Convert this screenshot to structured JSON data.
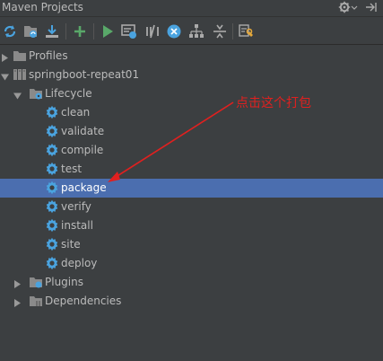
{
  "window": {
    "title": "Maven Projects"
  },
  "toolbar": {
    "icons": [
      "reimport-all-icon",
      "generate-sources-icon",
      "download-icon",
      "add-icon",
      "run-icon",
      "execute-goal-icon",
      "toggle-offline-icon",
      "skip-tests-icon",
      "show-dependencies-icon",
      "collapse-all-icon",
      "settings-icon"
    ]
  },
  "tree": {
    "profiles": "Profiles",
    "project": "springboot-repeat01",
    "lifecycle": "Lifecycle",
    "goals": [
      "clean",
      "validate",
      "compile",
      "test",
      "package",
      "verify",
      "install",
      "site",
      "deploy"
    ],
    "plugins": "Plugins",
    "dependencies": "Dependencies"
  },
  "annotation": {
    "text": "点击这个打包",
    "color": "#e0201f"
  }
}
